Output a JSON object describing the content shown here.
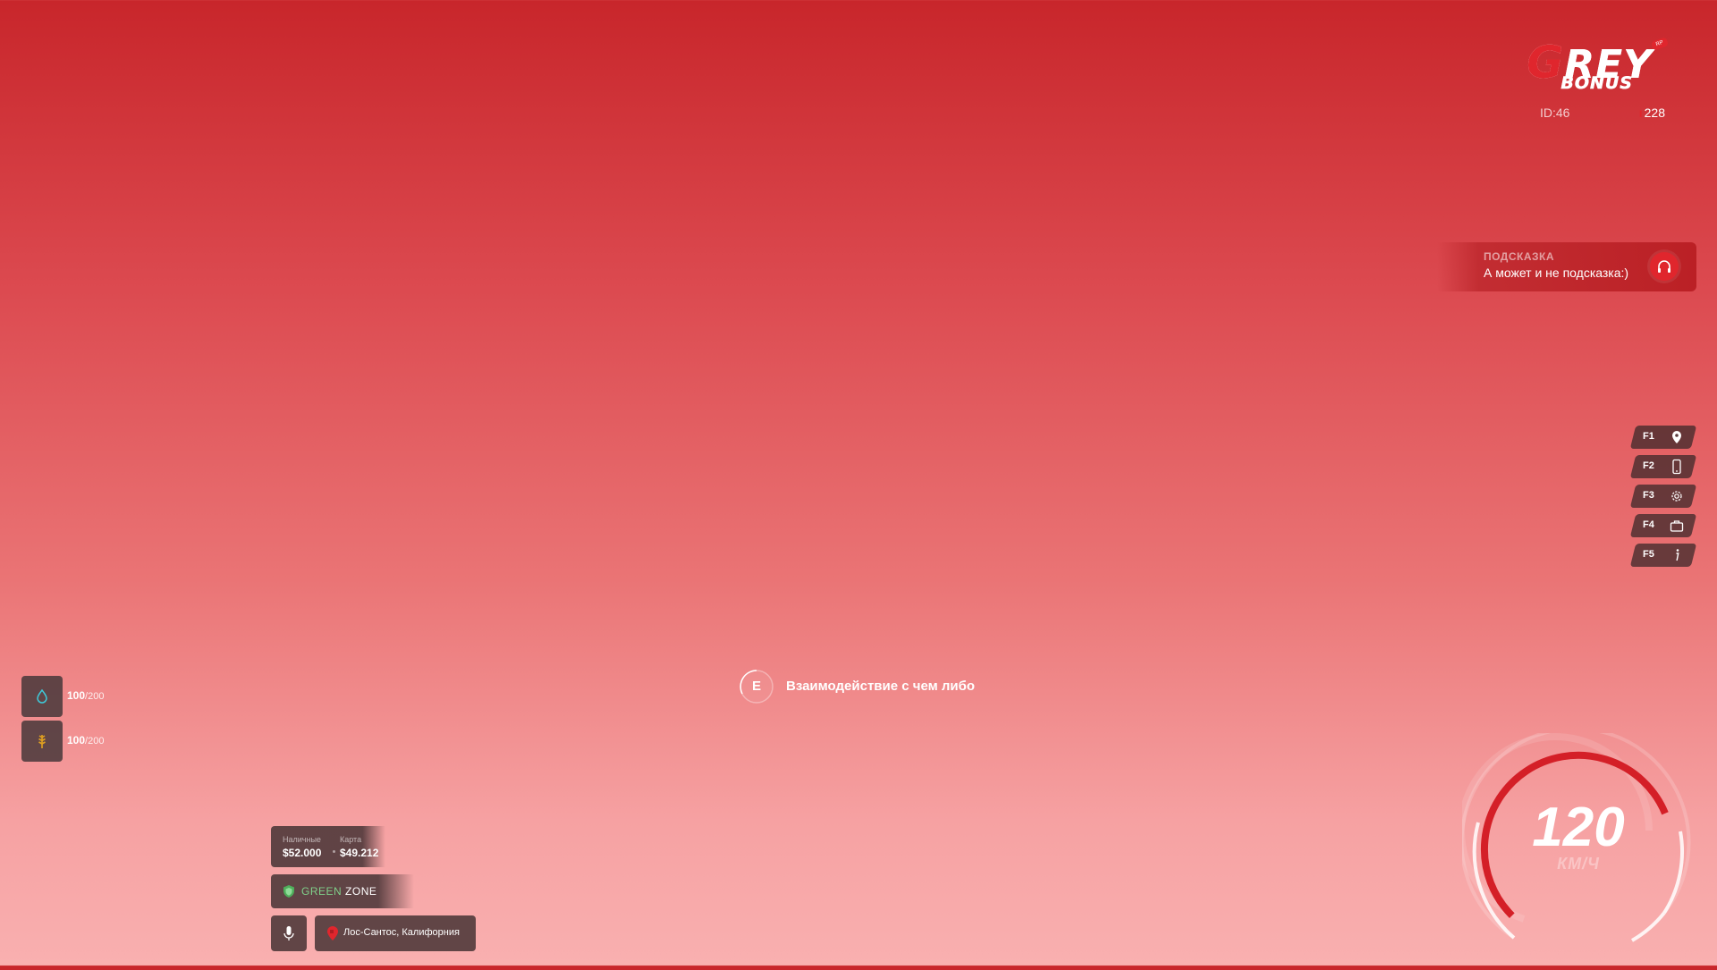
{
  "logo": {
    "line1_first": "G",
    "line1_rest": "REY",
    "line2": "BONUS",
    "badge": "RP"
  },
  "player": {
    "id_text": "ID:46",
    "online": "228"
  },
  "hint": {
    "title": "ПОДСКАЗКА",
    "text": "А может и не подсказка:)",
    "icon": "headphones-icon"
  },
  "fkeys": [
    {
      "label": "F1",
      "icon": "map-pin-icon"
    },
    {
      "label": "F2",
      "icon": "phone-icon"
    },
    {
      "label": "F3",
      "icon": "gear-icon"
    },
    {
      "label": "F4",
      "icon": "bag-icon"
    },
    {
      "label": "F5",
      "icon": "info-icon"
    }
  ],
  "interaction": {
    "key": "E",
    "text": "Взаимодействие с чем либо"
  },
  "stats": [
    {
      "name": "water",
      "value": "100",
      "max": "/200",
      "icon": "water-drop-icon",
      "color": "#3ec8d8"
    },
    {
      "name": "food",
      "value": "100",
      "max": "/200",
      "icon": "wheat-icon",
      "color": "#e0a020"
    }
  ],
  "money": {
    "cash_label": "Наличные",
    "cash_value": "$52.000",
    "card_label": "Карта",
    "card_value": "$49.212"
  },
  "zone": {
    "word1": "GREEN",
    "word2": "ZONE",
    "color": "#7fd08a"
  },
  "location": {
    "text": "Лос-Сантос, Калифорния"
  },
  "speedometer": {
    "value": "120",
    "unit": "КМ/Ч",
    "level": 0.75,
    "accent": "#d41f27"
  },
  "colors": {
    "accent": "#e0262d"
  }
}
